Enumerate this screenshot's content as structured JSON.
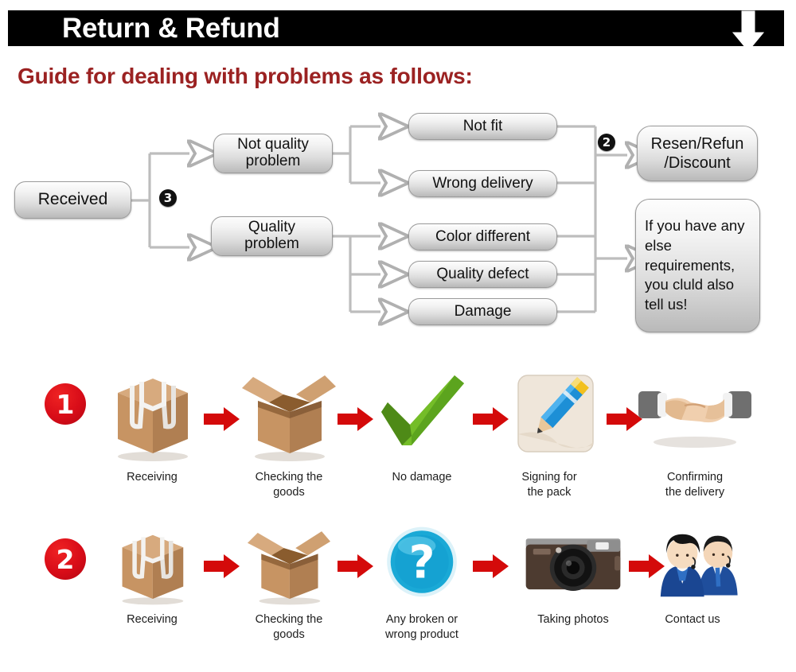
{
  "header": {
    "title": "Return & Refund",
    "arrow_icon": "down-arrow-icon",
    "bar_color": "#000000",
    "text_color": "#ffffff"
  },
  "guide": {
    "heading": "Guide for dealing with problems as follows:",
    "heading_color": "#9b2222"
  },
  "flowchart": {
    "nodes": {
      "received": "Received",
      "not_quality_problem": "Not quality\nproblem",
      "quality_problem": "Quality\nproblem",
      "not_fit": "Not fit",
      "wrong_delivery": "Wrong delivery",
      "color_different": "Color different",
      "quality_defect": "Quality defect",
      "damage": "Damage",
      "resend_refund_discount": "Resen/Refun\n/Discount",
      "else_requirements": "If you have any else requirements, you cluld also tell us!"
    },
    "badges": {
      "branch_three": "3",
      "branch_two": "2"
    },
    "connector_color": "#b6b6b6"
  },
  "process_rows": [
    {
      "number": "1",
      "steps": [
        {
          "icon": "sealed-box-icon",
          "label": "Receiving"
        },
        {
          "icon": "open-box-icon",
          "label": "Checking the\ngoods"
        },
        {
          "icon": "green-check-icon",
          "label": "No damage"
        },
        {
          "icon": "pencil-signing-icon",
          "label": "Signing for\nthe pack"
        },
        {
          "icon": "handshake-icon",
          "label": "Confirming\nthe delivery"
        }
      ]
    },
    {
      "number": "2",
      "steps": [
        {
          "icon": "sealed-box-icon",
          "label": "Receiving"
        },
        {
          "icon": "open-box-icon",
          "label": "Checking the\ngoods"
        },
        {
          "icon": "blue-question-icon",
          "label": "Any broken or\nwrong product"
        },
        {
          "icon": "camera-icon",
          "label": "Taking photos"
        },
        {
          "icon": "support-agents-icon",
          "label": "Contact us"
        }
      ]
    }
  ],
  "colors": {
    "red_arrow": "#d40a0a",
    "row_number_badge": "#d80c18",
    "node_border": "#9a9a9a"
  }
}
